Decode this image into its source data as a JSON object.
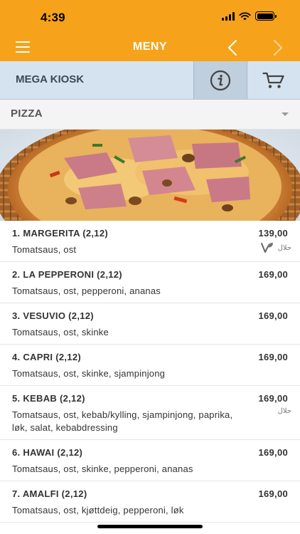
{
  "status_bar": {
    "time": "4:39"
  },
  "nav": {
    "title": "MENY"
  },
  "store": {
    "name": "MEGA KIOSK"
  },
  "category": {
    "selected": "PIZZA"
  },
  "menu": {
    "items": [
      {
        "name": "1. MARGERITA (2,12)",
        "price": "139,00",
        "description": "Tomatsaus, ost",
        "tags": [
          "vegetarian-icon",
          "halal"
        ],
        "halal_label": "حلال"
      },
      {
        "name": "2. LA PEPPERONI (2,12)",
        "price": "169,00",
        "description": "Tomatsaus, ost, pepperoni, ananas"
      },
      {
        "name": "3. VESUVIO (2,12)",
        "price": "169,00",
        "description": "Tomatsaus, ost, skinke"
      },
      {
        "name": "4. CAPRI (2,12)",
        "price": "169,00",
        "description": "Tomatsaus, ost, skinke, sjampinjong"
      },
      {
        "name": "5. KEBAB (2,12)",
        "price": "169,00",
        "description": "Tomatsaus, ost, kebab/kylling, sjampinjong, paprika, løk, salat, kebabdressing",
        "tags": [
          "halal"
        ],
        "halal_label": "حلال"
      },
      {
        "name": "6. HAWAI (2,12)",
        "price": "169,00",
        "description": "Tomatsaus, ost, skinke, pepperoni, ananas"
      },
      {
        "name": "7. AMALFI (2,12)",
        "price": "169,00",
        "description": "Tomatsaus, ost, kjøttdeig, pepperoni, løk"
      }
    ]
  },
  "colors": {
    "accent": "#f7a21b",
    "store_bar": "#d5e3f0",
    "text": "#333333"
  }
}
